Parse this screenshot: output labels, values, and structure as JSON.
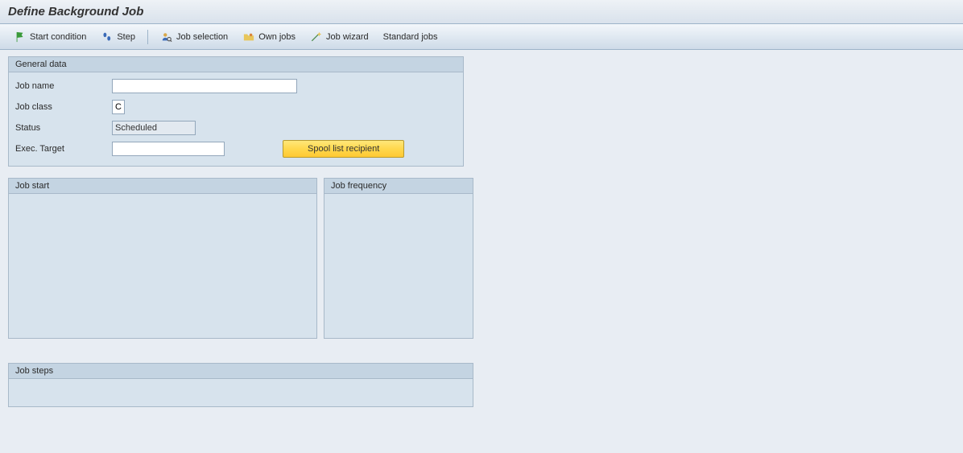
{
  "header": {
    "title": "Define Background Job"
  },
  "toolbar": {
    "start_condition": "Start condition",
    "step": "Step",
    "job_selection": "Job selection",
    "own_jobs": "Own jobs",
    "job_wizard": "Job wizard",
    "standard_jobs": "Standard jobs"
  },
  "general": {
    "groupbox_title": "General data",
    "labels": {
      "job_name": "Job name",
      "job_class": "Job class",
      "status": "Status",
      "exec_target": "Exec. Target"
    },
    "values": {
      "job_name": "",
      "job_class": "C",
      "status": "Scheduled",
      "exec_target": ""
    },
    "buttons": {
      "spool_recipient": "Spool list recipient"
    }
  },
  "jobstart": {
    "title": "Job start"
  },
  "jobfreq": {
    "title": "Job frequency"
  },
  "jobsteps": {
    "title": "Job steps"
  }
}
